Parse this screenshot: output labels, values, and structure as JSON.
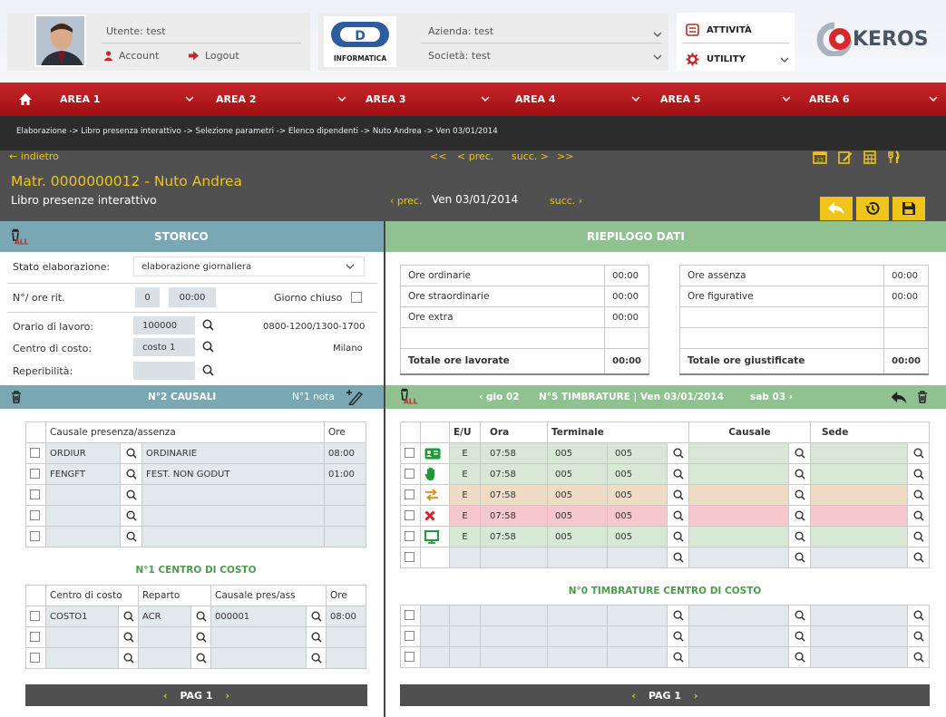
{
  "header": {
    "user_label": "Utente: test",
    "account_label": "Account",
    "logout_label": "Logout",
    "logo_text": "INFORMATICA",
    "azienda_label": "Azienda: test",
    "societa_label": "Società: test",
    "attivita_label": "ATTIVITÀ",
    "utility_label": "UTILITY",
    "brand": "KEROS"
  },
  "nav": {
    "areas": [
      "AREA 1",
      "AREA 2",
      "AREA 3",
      "AREA 4",
      "AREA 5",
      "AREA 6"
    ]
  },
  "breadcrumb": "Elaborazione -> Libro presenza interattivo -> Selezione parametri -> Elenco dipendenti -> Nuto Andrea -> Ven 03/01/2014",
  "subbar": {
    "back": "← indietro",
    "first": "<<",
    "prev": "< prec.",
    "next": "succ. >",
    "last": ">>",
    "employee": "Matr. 0000000012  - Nuto Andrea",
    "page_title": "Libro presenze interattivo",
    "day_prev": "‹ prec.",
    "date": "Ven 03/01/2014",
    "day_next": "succ. ›"
  },
  "storico": {
    "title": "STORICO",
    "stato_label": "Stato elaborazione:",
    "stato_value": "elaborazione giornaliera",
    "ore_rit_label": "N°/ ore rit.",
    "ore_rit_count": "0",
    "ore_rit_time": "00:00",
    "giorno_chiuso_label": "Giorno chiuso",
    "orario_label": "Orario di lavoro:",
    "orario_value": "100000",
    "orario_desc": "0800-1200/1300-1700",
    "centro_label": "Centro di costo:",
    "centro_value": "costo 1",
    "centro_desc": "Milano",
    "reper_label": "Reperibilità:"
  },
  "causali": {
    "title": "N°2 CAUSALI",
    "nota": "N°1 nota",
    "col_causale": "Causale presenza/assenza",
    "col_ore": "Ore",
    "rows": [
      {
        "code": "ORDIUR",
        "desc": "ORDINARIE",
        "ore": "08:00"
      },
      {
        "code": "FENGFT",
        "desc": "FEST. NON GODUT",
        "ore": "01:00"
      },
      {
        "code": "",
        "desc": "",
        "ore": ""
      },
      {
        "code": "",
        "desc": "",
        "ore": ""
      },
      {
        "code": "",
        "desc": "",
        "ore": ""
      }
    ]
  },
  "centro_costo": {
    "title": "N°1 CENTRO DI COSTO",
    "col_centro": "Centro di costo",
    "col_reparto": "Reparto",
    "col_causale": "Causale pres/ass",
    "col_ore": "Ore",
    "rows": [
      {
        "centro": "COSTO1",
        "reparto": "ACR",
        "causale": "000001",
        "ore": "08:00"
      },
      {
        "centro": "",
        "reparto": "",
        "causale": "",
        "ore": ""
      },
      {
        "centro": "",
        "reparto": "",
        "causale": "",
        "ore": ""
      }
    ]
  },
  "left_pager": {
    "prev": "‹",
    "label": "PAG  1",
    "next": "›"
  },
  "riepilogo": {
    "title": "RIEPILOGO DATI",
    "left": [
      {
        "label": "Ore ordinarie",
        "value": "00:00"
      },
      {
        "label": "Ore straordinarie",
        "value": "00:00"
      },
      {
        "label": "Ore extra",
        "value": "00:00"
      },
      {
        "label": "",
        "value": ""
      }
    ],
    "left_total_label": "Totale ore lavorate",
    "left_total_value": "00:00",
    "right": [
      {
        "label": "Ore assenza",
        "value": "00:00"
      },
      {
        "label": "Ore figurative",
        "value": "00:00"
      },
      {
        "label": "",
        "value": ""
      },
      {
        "label": "",
        "value": ""
      }
    ],
    "right_total_label": "Totale ore giustificate",
    "right_total_value": "00:00"
  },
  "timbrature": {
    "prev_day": "‹ gio 02",
    "title": "N°5 TIMBRATURE | Ven 03/01/2014",
    "next_day": "sab 03 ›",
    "col_eu": "E/U",
    "col_ora": "Ora",
    "col_terminale": "Terminale",
    "col_causale": "Causale",
    "col_sede": "Sede",
    "rows": [
      {
        "icon": "badge",
        "eu": "E",
        "ora": "07:58",
        "t1": "005",
        "t2": "005",
        "tone": "ltgrn"
      },
      {
        "icon": "hand",
        "eu": "E",
        "ora": "07:58",
        "t1": "005",
        "t2": "005",
        "tone": "ltgrn"
      },
      {
        "icon": "swap",
        "eu": "E",
        "ora": "07:58",
        "t1": "005",
        "t2": "005",
        "tone": "ltorg"
      },
      {
        "icon": "cross",
        "eu": "E",
        "ora": "07:58",
        "t1": "005",
        "t2": "005",
        "tone": "ltred"
      },
      {
        "icon": "monitor",
        "eu": "E",
        "ora": "07:58",
        "t1": "005",
        "t2": "005",
        "tone": "ltgrn"
      },
      {
        "icon": "",
        "eu": "",
        "ora": "",
        "t1": "",
        "t2": "",
        "tone": "ltblue"
      }
    ],
    "cc_title": "N°0 TIMBRATURE CENTRO DI COSTO"
  },
  "right_pager": {
    "prev": "‹",
    "label": "PAG  1",
    "next": "›"
  },
  "colors": {
    "nav_red": "#b5191d",
    "teal": "#7aa7b4",
    "green": "#8fc290",
    "yellow": "#f0c419"
  }
}
